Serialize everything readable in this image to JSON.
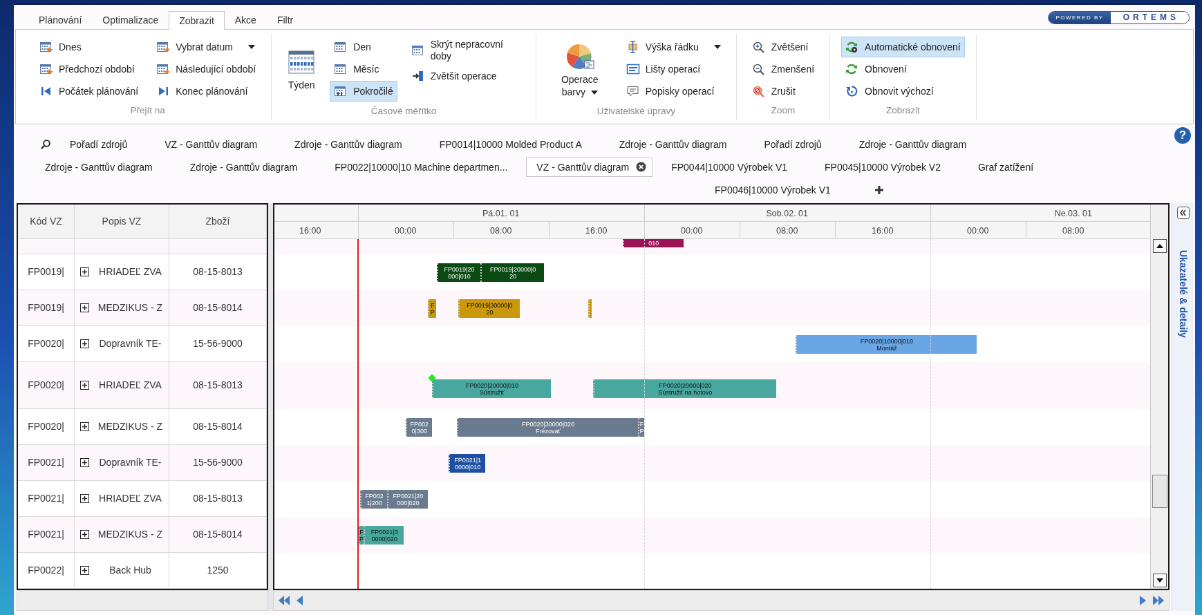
{
  "ribbon_tabs": [
    {
      "label": "Plánování",
      "selected": false
    },
    {
      "label": "Optimalizace",
      "selected": false
    },
    {
      "label": "Zobrazit",
      "selected": true
    },
    {
      "label": "Akce",
      "selected": false
    },
    {
      "label": "Filtr",
      "selected": false
    }
  ],
  "logo": {
    "prefix": "POWERED BY",
    "name": "ORTEMS"
  },
  "ribbon_groups": [
    {
      "label": "Přejít na",
      "columns": [
        [
          {
            "label": "Dnes",
            "kind": "small",
            "selected": false,
            "dropdown": false
          },
          {
            "label": "Předchozí období",
            "kind": "small",
            "selected": false,
            "dropdown": false
          },
          {
            "label": "Počátek plánování",
            "kind": "small",
            "selected": false,
            "dropdown": false
          }
        ],
        [
          {
            "label": "Vybrat datum",
            "kind": "small",
            "selected": false,
            "dropdown": true
          },
          {
            "label": "Následující období",
            "kind": "small",
            "selected": false,
            "dropdown": false
          },
          {
            "label": "Konec plánování",
            "kind": "small",
            "selected": false,
            "dropdown": false
          }
        ]
      ]
    },
    {
      "label": "Časové měřítko",
      "columns": [
        [
          {
            "label": "Týden",
            "kind": "large",
            "selected": false,
            "dropdown": false
          }
        ],
        [
          {
            "label": "Den",
            "kind": "small",
            "selected": false,
            "dropdown": false
          },
          {
            "label": "Měsíc",
            "kind": "small",
            "selected": false,
            "dropdown": false
          },
          {
            "label": "Pokročilé",
            "kind": "small",
            "selected": true,
            "dropdown": false
          }
        ],
        [
          {
            "label": "Skrýt nepracovní doby",
            "kind": "small",
            "selected": false,
            "dropdown": false
          },
          {
            "label": "Zvětšit operace",
            "kind": "small",
            "selected": false,
            "dropdown": false
          }
        ]
      ]
    },
    {
      "label": "Uživatelské úpravy",
      "columns": [
        [
          {
            "label": "Operace barvy",
            "kind": "large",
            "selected": false,
            "dropdown": true
          }
        ],
        [
          {
            "label": "Výška řádku",
            "kind": "small",
            "selected": false,
            "dropdown": true
          },
          {
            "label": "Lišty operací",
            "kind": "small",
            "selected": false,
            "dropdown": false
          },
          {
            "label": "Popisky operací",
            "kind": "small",
            "selected": false,
            "dropdown": false
          }
        ]
      ]
    },
    {
      "label": "Zoom",
      "columns": [
        [
          {
            "label": "Zvětšení",
            "kind": "small",
            "selected": false,
            "dropdown": false
          },
          {
            "label": "Zmenšení",
            "kind": "small",
            "selected": false,
            "dropdown": false
          },
          {
            "label": "Zrušit",
            "kind": "small",
            "selected": false,
            "dropdown": false
          }
        ]
      ]
    },
    {
      "label": "Zobrazit",
      "columns": [
        [
          {
            "label": "Automatické obnovení",
            "kind": "small",
            "selected": true,
            "dropdown": false
          },
          {
            "label": "Obnovení",
            "kind": "small",
            "selected": false,
            "dropdown": false
          },
          {
            "label": "Obnovit výchozí",
            "kind": "small",
            "selected": false,
            "dropdown": false
          }
        ]
      ]
    }
  ],
  "help": "?",
  "document_tabs": [
    [
      {
        "label": "Pořadí zdrojů",
        "selected": false
      },
      {
        "label": "VZ - Ganttův diagram",
        "selected": false
      },
      {
        "label": "Zdroje - Ganttův diagram",
        "selected": false
      },
      {
        "label": "FP0014|10000 Molded Product A",
        "selected": false
      },
      {
        "label": "Zdroje - Ganttův diagram",
        "selected": false
      },
      {
        "label": "Pořadí zdrojů",
        "selected": false
      },
      {
        "label": "Zdroje - Ganttův diagram",
        "selected": false
      }
    ],
    [
      {
        "label": "Zdroje - Ganttův diagram",
        "selected": false
      },
      {
        "label": "Zdroje - Ganttův diagram",
        "selected": false
      },
      {
        "label": "FP0022|10000|10 Machine departmen...",
        "selected": false
      },
      {
        "label": "VZ - Ganttův diagram",
        "selected": true
      },
      {
        "label": "FP0044|10000 Výrobek V1",
        "selected": false
      },
      {
        "label": "FP0045|10000 Výrobek V2",
        "selected": false
      },
      {
        "label": "Graf zatížení",
        "selected": false
      }
    ],
    [
      {
        "label": "FP0046|10000 Výrobek V1",
        "selected": false
      }
    ]
  ],
  "schedule": {
    "columns": [
      "Kód VZ",
      "Popis VZ",
      "Zboží"
    ],
    "days": [
      "Pá.01. 01",
      "Sob.02. 01",
      "Ne.03. 01"
    ],
    "times": [
      "16:00",
      "00:00",
      "08:00",
      "16:00",
      "00:00",
      "08:00",
      "16:00",
      "00:00",
      "08:00"
    ],
    "rows": [
      {
        "milestone": false,
        "bars": [
          {
            "lines": [
              "010"
            ],
            "color": "#9b1457"
          }
        ]
      },
      {
        "code": "FP0019|",
        "description": "HRIADEĽ ZVA",
        "item": "08-15-8013",
        "milestone": false,
        "bars": [
          {
            "lines": [
              "FP0019|20",
              "000|010"
            ],
            "color": "#0b4a14"
          },
          {
            "lines": [
              "FP0019|20000|0",
              "20"
            ],
            "color": "#0b4a14"
          }
        ]
      },
      {
        "code": "FP0019|",
        "description": "MEDZIKUS - Z",
        "item": "08-15-8014",
        "milestone": false,
        "bars": [
          {
            "lines": [
              "F",
              "P"
            ],
            "color": "#c9980c"
          },
          {
            "lines": [
              "FP0019|30000|0",
              "20"
            ],
            "color": "#c9980c"
          },
          {
            "color": "#c9980c"
          }
        ]
      },
      {
        "code": "FP0020|",
        "description": "Dopravník TE-",
        "item": "15-56-9000",
        "milestone": false,
        "bars": [
          {
            "lines": [
              "FP0020|10000|010",
              "Montáž"
            ],
            "color": "#6aa6e6"
          }
        ]
      },
      {
        "code": "FP0020|",
        "description": "HRIADEĽ ZVA",
        "item": "08-15-8013",
        "milestone": true,
        "bars": [
          {
            "lines": [
              "FP0020|20000|010",
              "Sústružiť"
            ],
            "color": "#48a8a0"
          },
          {
            "lines": [
              "FP0020|20000|020",
              "Sústružiť na hotovo"
            ],
            "color": "#48a8a0"
          }
        ]
      },
      {
        "code": "FP0020|",
        "description": "MEDZIKUS - Z",
        "item": "08-15-8014",
        "milestone": false,
        "bars": [
          {
            "lines": [
              "FP002",
              "0|300"
            ],
            "color": "#6a7b90"
          },
          {
            "lines": [
              "FP0020|30000|020",
              "Frézovať"
            ],
            "color": "#6a7b90"
          },
          {
            "lines": [
              "F",
              "P"
            ],
            "color": "#6a7b90"
          }
        ]
      },
      {
        "code": "FP0021|",
        "description": "Dopravník TE-",
        "item": "15-56-9000",
        "milestone": false,
        "bars": [
          {
            "lines": [
              "FP0021|1",
              "0000|010"
            ],
            "color": "#1d4fa3"
          }
        ]
      },
      {
        "code": "FP0021|",
        "description": "HRIADEĽ ZVA",
        "item": "08-15-8013",
        "milestone": false,
        "bars": [
          {
            "lines": [
              "FP002",
              "1|200"
            ],
            "color": "#6a7b90"
          },
          {
            "lines": [
              "FP0021|20",
              "000|020"
            ],
            "color": "#6a7b90"
          }
        ]
      },
      {
        "code": "FP0021|",
        "description": "MEDZIKUS - Z",
        "item": "08-15-8014",
        "milestone": false,
        "bars": [
          {
            "lines": [
              "F",
              "P"
            ],
            "color": "#48a8a0"
          },
          {
            "lines": [
              "FP0021|3",
              "0000|020"
            ],
            "color": "#48a8a0"
          }
        ]
      },
      {
        "code": "FP0022|",
        "description": "Back Hub",
        "item": "1250",
        "milestone": false
      }
    ]
  },
  "side_panel": {
    "title": "Ukazatelé & detaily"
  }
}
